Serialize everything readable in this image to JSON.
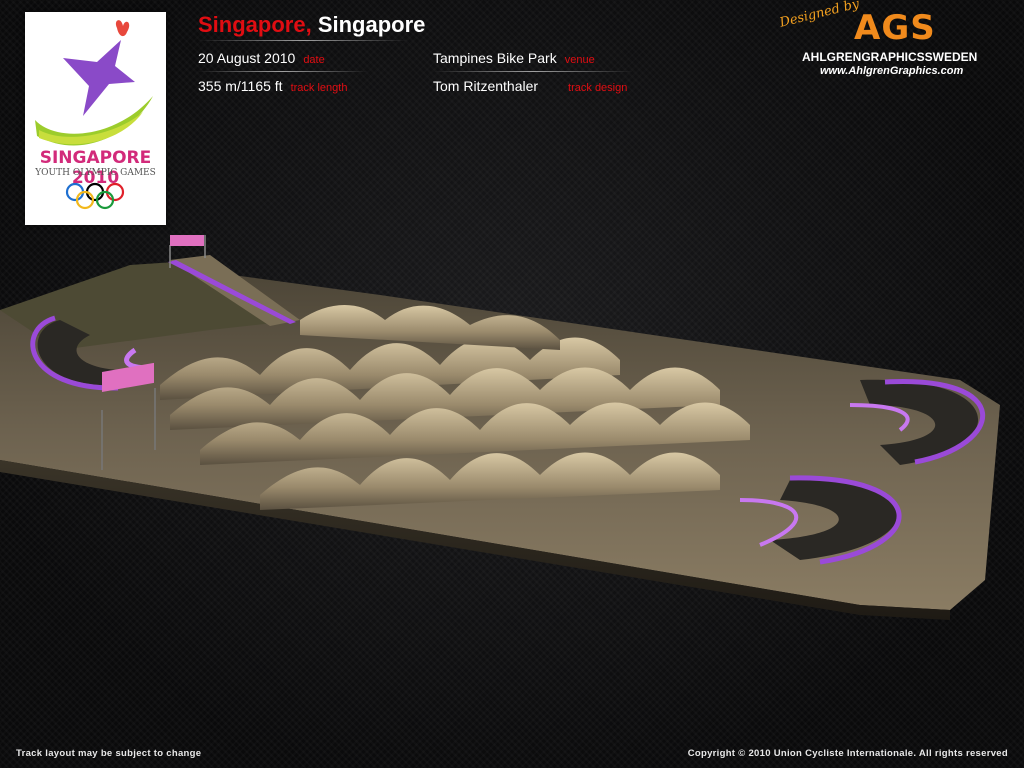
{
  "event": {
    "city": "Singapore,",
    "country": "Singapore"
  },
  "details": {
    "date_value": "20 August 2010",
    "date_label": "date",
    "venue_value": "Tampines Bike Park",
    "venue_label": "venue",
    "length_value": "355 m/1165 ft",
    "length_label": "track length",
    "design_value": "Tom Ritzenthaler",
    "design_label": "track design"
  },
  "logo": {
    "line1": "SINGAPORE 2010",
    "line2": "YOUTH OLYMPIC GAMES"
  },
  "designer": {
    "tag": "Designed by",
    "brand": "AGS",
    "name": "AHLGRENGRAPHICSSWEDEN",
    "url": "www.AhlgrenGraphics.com"
  },
  "footer": {
    "left": "Track layout may be subject to change",
    "right": "Copyright © 2010 Union Cycliste Internationale. All rights reserved"
  },
  "colors": {
    "accent_red": "#e00d12",
    "brand_orange": "#f08a1c",
    "track_purple": "#8a3fd0"
  }
}
